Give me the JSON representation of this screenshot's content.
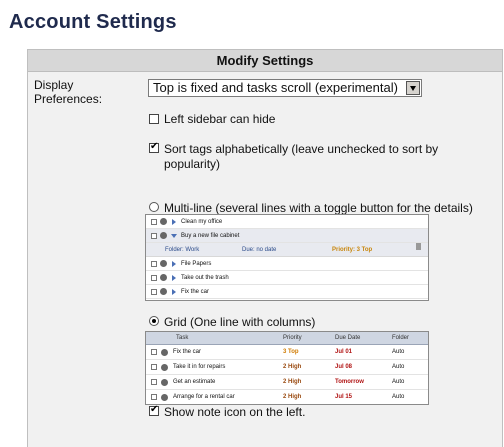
{
  "page": {
    "title": "Account Settings"
  },
  "panel": {
    "header": "Modify Settings"
  },
  "display": {
    "label_line1": "Display",
    "label_line2": "Preferences:",
    "select_value": "Top is fixed and tasks scroll (experimental)"
  },
  "options": {
    "left_sidebar": {
      "label": "Left sidebar can hide",
      "checked": false
    },
    "sort_tags": {
      "label_line1": "Sort tags alphabetically (leave unchecked to sort by",
      "label_line2": "popularity)",
      "checked": true
    },
    "multiline": {
      "label": "Multi-line (several lines with a toggle button for the details)",
      "selected": false
    },
    "grid": {
      "label": "Grid (One line with columns)",
      "selected": true
    },
    "show_note_icon": {
      "label": "Show note icon on the left.",
      "checked": true
    }
  },
  "multiline_preview": {
    "rows": [
      {
        "task": "Clean my office"
      },
      {
        "task": "Buy a new file cabinet"
      },
      {
        "task": "File Papers"
      },
      {
        "task": "Take out the trash"
      },
      {
        "task": "Fix the car"
      }
    ],
    "detail": {
      "folder": "Folder: Work",
      "due": "Due: no date",
      "priority": "Priority: 3 Top"
    }
  },
  "grid_preview": {
    "columns": [
      "Task",
      "Priority",
      "Due Date",
      "Folder"
    ],
    "rows": [
      {
        "task": "Fix the car",
        "priority": "3 Top",
        "due": "Jul 01",
        "folder": "Auto"
      },
      {
        "task": "Take it in for repairs",
        "priority": "2 High",
        "due": "Jul 08",
        "folder": "Auto"
      },
      {
        "task": "Get an estimate",
        "priority": "2 High",
        "due": "Tomorrow",
        "folder": "Auto"
      },
      {
        "task": "Arrange for a rental car",
        "priority": "2 High",
        "due": "Jul 15",
        "folder": "Auto"
      }
    ]
  },
  "colors": {
    "title": "#1f2a4d",
    "panel_bg": "#f1f1f1",
    "panel_header_bg": "#d7d7d7",
    "due_red": "#b01212",
    "priority_top": "#d07b00",
    "priority_high": "#9a4a10"
  }
}
